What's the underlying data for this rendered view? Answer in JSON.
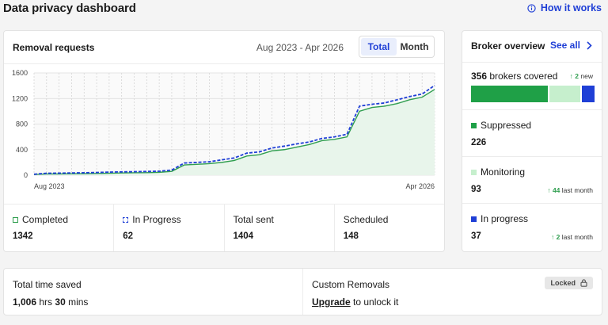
{
  "page": {
    "title": "Data privacy dashboard",
    "how_it_works": "How it works"
  },
  "removal": {
    "title": "Removal requests",
    "date_range": "Aug 2023 - Apr 2026",
    "toggle": {
      "total": "Total",
      "month": "Month",
      "selected": "Total"
    },
    "stats": [
      {
        "label": "Completed",
        "value": "1342"
      },
      {
        "label": "In Progress",
        "value": "62"
      },
      {
        "label": "Total sent",
        "value": "1404"
      },
      {
        "label": "Scheduled",
        "value": "148"
      }
    ]
  },
  "chart_data": {
    "type": "area",
    "y_ticks": [
      0,
      400,
      800,
      1200,
      1600
    ],
    "ylim": [
      0,
      1600
    ],
    "x_start_label": "Aug 2023",
    "x_end_label": "Apr 2026",
    "grid": true,
    "series": [
      {
        "name": "Completed",
        "color": "#2f9e4f",
        "fill": "#e8f5eb",
        "values": [
          10,
          20,
          20,
          22,
          24,
          27,
          30,
          35,
          38,
          40,
          45,
          60,
          160,
          170,
          180,
          200,
          230,
          300,
          320,
          380,
          400,
          440,
          480,
          540,
          560,
          600,
          1000,
          1060,
          1080,
          1120,
          1180,
          1220,
          1342
        ]
      },
      {
        "name": "In Progress",
        "color": "#1f3fd6",
        "style": "dashed",
        "values": [
          15,
          30,
          32,
          35,
          38,
          42,
          48,
          52,
          55,
          58,
          62,
          80,
          190,
          200,
          210,
          240,
          270,
          345,
          365,
          425,
          455,
          490,
          520,
          575,
          600,
          640,
          1080,
          1110,
          1130,
          1180,
          1230,
          1270,
          1404
        ]
      }
    ]
  },
  "broker": {
    "title": "Broker overview",
    "see_all": "See all",
    "covered_count": "356",
    "covered_text": "brokers covered",
    "new_count": "2",
    "new_text": "new",
    "bar": [
      {
        "share": 226,
        "color": "#1fa047"
      },
      {
        "share": 93,
        "color": "#c6efcd"
      },
      {
        "share": 37,
        "color": "#1f3fd6"
      }
    ],
    "rows": [
      {
        "label": "Suppressed",
        "value": "226",
        "color": "#1fa047",
        "delta": "",
        "delta_text": ""
      },
      {
        "label": "Monitoring",
        "value": "93",
        "color": "#c6efcd",
        "delta": "44",
        "delta_text": "last month"
      },
      {
        "label": "In progress",
        "value": "37",
        "color": "#1f3fd6",
        "delta": "2",
        "delta_text": "last month"
      }
    ]
  },
  "bottom": {
    "time_label": "Total time saved",
    "hrs": "1,006",
    "hrs_unit": "hrs",
    "mins": "30",
    "mins_unit": "mins",
    "custom_label": "Custom Removals",
    "locked": "Locked",
    "upgrade": "Upgrade",
    "unlock_text": "to unlock it"
  }
}
